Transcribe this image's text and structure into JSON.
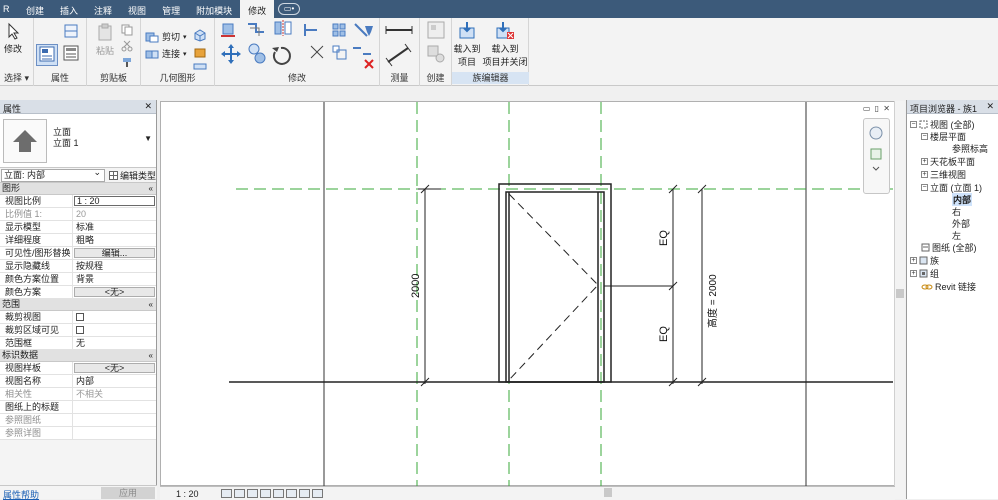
{
  "menu": {
    "logo": "R",
    "tabs": [
      "创建",
      "插入",
      "注释",
      "视图",
      "管理",
      "附加模块",
      "修改"
    ],
    "active_tab": "修改",
    "context_icon": "▭•"
  },
  "ribbon": {
    "modify_btn": "修改",
    "select_panel": "选择 ▾",
    "properties_panel": "属性",
    "paste_btn": "粘贴",
    "clipboard_panel": "剪贴板",
    "cut": "剪切",
    "join": "连接",
    "geometry_panel": "几何图形",
    "modify_panel": "修改",
    "measure_panel": "测量",
    "create_panel": "创建",
    "load_into_project": "载入到\n项目",
    "load_into_project_l1": "载入到",
    "load_into_project_l2": "项目",
    "load_and_close_l1": "载入到",
    "load_and_close_l2": "项目并关闭",
    "family_editor_panel": "族编辑器"
  },
  "properties": {
    "title": "属性",
    "type_line1": "立面",
    "type_line2": "立面 1",
    "filter": "立面: 内部",
    "edit_type": "编辑类型",
    "sections": {
      "graphics": "图形",
      "extents": "范围",
      "identity": "标识数据"
    },
    "graphics_rows": [
      {
        "k": "视图比例",
        "v": "1 : 20"
      },
      {
        "k": "比例值 1:",
        "v": "20"
      },
      {
        "k": "显示模型",
        "v": "标准"
      },
      {
        "k": "详细程度",
        "v": "粗略"
      },
      {
        "k": "可见性/图形替换",
        "v": "编辑..."
      },
      {
        "k": "显示隐藏线",
        "v": "按规程"
      },
      {
        "k": "颜色方案位置",
        "v": "背景"
      },
      {
        "k": "颜色方案",
        "v": "<无>"
      }
    ],
    "extents_rows": [
      {
        "k": "裁剪视图",
        "v": ""
      },
      {
        "k": "裁剪区域可见",
        "v": ""
      },
      {
        "k": "范围框",
        "v": "无"
      }
    ],
    "identity_rows": [
      {
        "k": "视图样板",
        "v": "<无>"
      },
      {
        "k": "视图名称",
        "v": "内部"
      },
      {
        "k": "相关性",
        "v": "不相关"
      },
      {
        "k": "图纸上的标题",
        "v": ""
      },
      {
        "k": "参照图纸",
        "v": ""
      },
      {
        "k": "参照详图",
        "v": ""
      }
    ],
    "help_link": "属性帮助",
    "apply_btn": "应用"
  },
  "canvas": {
    "dim_left": "2000",
    "dim_eq_top": "EQ",
    "dim_eq_bottom": "EQ",
    "dim_height": "高度 = 2000",
    "view_controls": "▭ ▯ ✕"
  },
  "viewbar": {
    "scale": "1 : 20"
  },
  "browser": {
    "title": "项目浏览器 - 族1",
    "close": "✕",
    "nodes": [
      {
        "label": "视图 (全部)",
        "level": 0,
        "toggle": "−"
      },
      {
        "label": "楼层平面",
        "level": 1,
        "toggle": "−"
      },
      {
        "label": "参照标高",
        "level": 2,
        "toggle": ""
      },
      {
        "label": "天花板平面",
        "level": 1,
        "toggle": "+"
      },
      {
        "label": "三维视图",
        "level": 1,
        "toggle": "+"
      },
      {
        "label": "立面 (立面 1)",
        "level": 1,
        "toggle": "−"
      },
      {
        "label": "内部",
        "level": 2,
        "toggle": "",
        "selected": true
      },
      {
        "label": "右",
        "level": 2,
        "toggle": ""
      },
      {
        "label": "外部",
        "level": 2,
        "toggle": ""
      },
      {
        "label": "左",
        "level": 2,
        "toggle": ""
      },
      {
        "label": "图纸 (全部)",
        "level": 0,
        "toggle": ""
      },
      {
        "label": "族",
        "level": 0,
        "toggle": "+"
      },
      {
        "label": "组",
        "level": 0,
        "toggle": "+"
      },
      {
        "label": "Revit 链接",
        "level": 0,
        "toggle": ""
      }
    ]
  },
  "colors": {
    "menubar": "#3c5a7a",
    "ref_plane": "#3aa83a",
    "selected": "#cfe3fb"
  }
}
